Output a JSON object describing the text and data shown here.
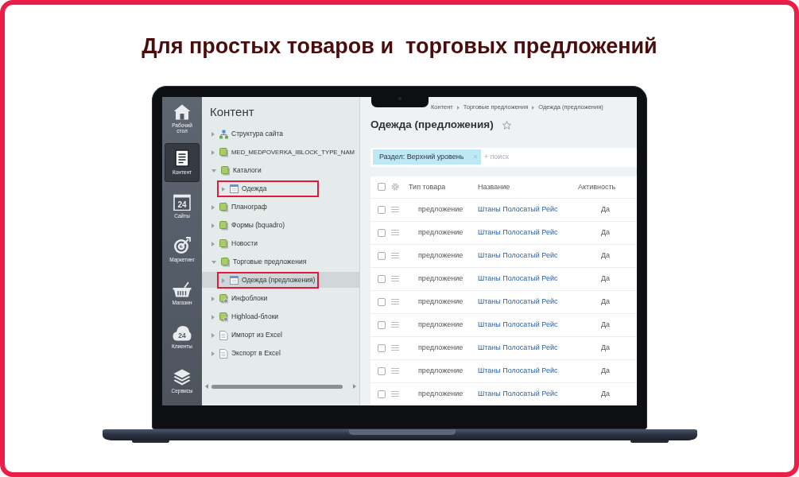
{
  "heading": "Для простых товаров и  торговых предложений",
  "sidebar": {
    "items": [
      {
        "label": "Рабочий стол",
        "kind": "home",
        "selected": false
      },
      {
        "label": "Контент",
        "kind": "content",
        "selected": true
      },
      {
        "label": "Сайты",
        "kind": "calendar",
        "icon_text": "24",
        "selected": false
      },
      {
        "label": "Маркетинг",
        "kind": "target",
        "selected": false
      },
      {
        "label": "Магазин",
        "kind": "basket",
        "selected": false
      },
      {
        "label": "Клиенты",
        "kind": "cloud",
        "icon_text": "24",
        "selected": false
      },
      {
        "label": "Сервисы",
        "kind": "layers",
        "selected": false
      }
    ]
  },
  "tree": {
    "title": "Контент",
    "items": [
      {
        "label": "Структура сайта",
        "kind": "structure",
        "expanded": false,
        "selected": false,
        "highlighted": false
      },
      {
        "label": "MED_MEDPOVERKA_IBLOCK_TYPE_NAM",
        "kind": "iblock-type",
        "expanded": false,
        "selected": false,
        "highlighted": false
      },
      {
        "label": "Каталоги",
        "kind": "iblock-type",
        "expanded": true,
        "selected": false,
        "highlighted": false,
        "children": [
          {
            "label": "Одежда",
            "kind": "iblock",
            "expanded": false,
            "selected": false,
            "highlighted": true
          }
        ]
      },
      {
        "label": "Планограф",
        "kind": "iblock-type",
        "expanded": false,
        "selected": false,
        "highlighted": false
      },
      {
        "label": "Формы (bquadro)",
        "kind": "iblock-type",
        "expanded": false,
        "selected": false,
        "highlighted": false
      },
      {
        "label": "Новости",
        "kind": "iblock-type",
        "expanded": false,
        "selected": false,
        "highlighted": false
      },
      {
        "label": "Торговые предложения",
        "kind": "iblock-type",
        "expanded": true,
        "selected": false,
        "highlighted": false,
        "children": [
          {
            "label": "Одежда (предложения)",
            "kind": "iblock",
            "expanded": false,
            "selected": true,
            "highlighted": true
          }
        ]
      },
      {
        "label": "Инфоблоки",
        "kind": "settings",
        "expanded": false,
        "selected": false,
        "highlighted": false
      },
      {
        "label": "Highload-блоки",
        "kind": "settings",
        "expanded": false,
        "selected": false,
        "highlighted": false
      },
      {
        "label": "Импорт из Excel",
        "kind": "page",
        "expanded": false,
        "selected": false,
        "highlighted": false
      },
      {
        "label": "Экспорт в Excel",
        "kind": "page",
        "expanded": false,
        "selected": false,
        "highlighted": false
      }
    ]
  },
  "main": {
    "breadcrumbs": [
      "Контент",
      "Торговые предложения",
      "Одежда (предложения)"
    ],
    "title": "Одежда (предложения)",
    "starred": false,
    "filter": {
      "tag": "Раздел: Верхний уровень",
      "remove": "×",
      "placeholder": "+ поиск"
    },
    "table": {
      "header_checked": false,
      "columns": [
        "Тип товара",
        "Название",
        "Активность"
      ],
      "rows": [
        {
          "type": "предложение",
          "name": "Штаны Полосатый Рейс",
          "active": "Да",
          "checked": false
        },
        {
          "type": "предложение",
          "name": "Штаны Полосатый Рейс",
          "active": "Да",
          "checked": false
        },
        {
          "type": "предложение",
          "name": "Штаны Полосатый Рейс",
          "active": "Да",
          "checked": false
        },
        {
          "type": "предложение",
          "name": "Штаны Полосатый Рейс",
          "active": "Да",
          "checked": false
        },
        {
          "type": "предложение",
          "name": "Штаны Полосатый Рейс",
          "active": "Да",
          "checked": false
        },
        {
          "type": "предложение",
          "name": "Штаны Полосатый Рейс",
          "active": "Да",
          "checked": false
        },
        {
          "type": "предложение",
          "name": "Штаны Полосатый Рейс",
          "active": "Да",
          "checked": false
        },
        {
          "type": "предложение",
          "name": "Штаны Полосатый Рейс",
          "active": "Да",
          "checked": false
        },
        {
          "type": "предложение",
          "name": "Штаны Полосатый Рейс",
          "active": "Да",
          "checked": false
        }
      ]
    }
  }
}
